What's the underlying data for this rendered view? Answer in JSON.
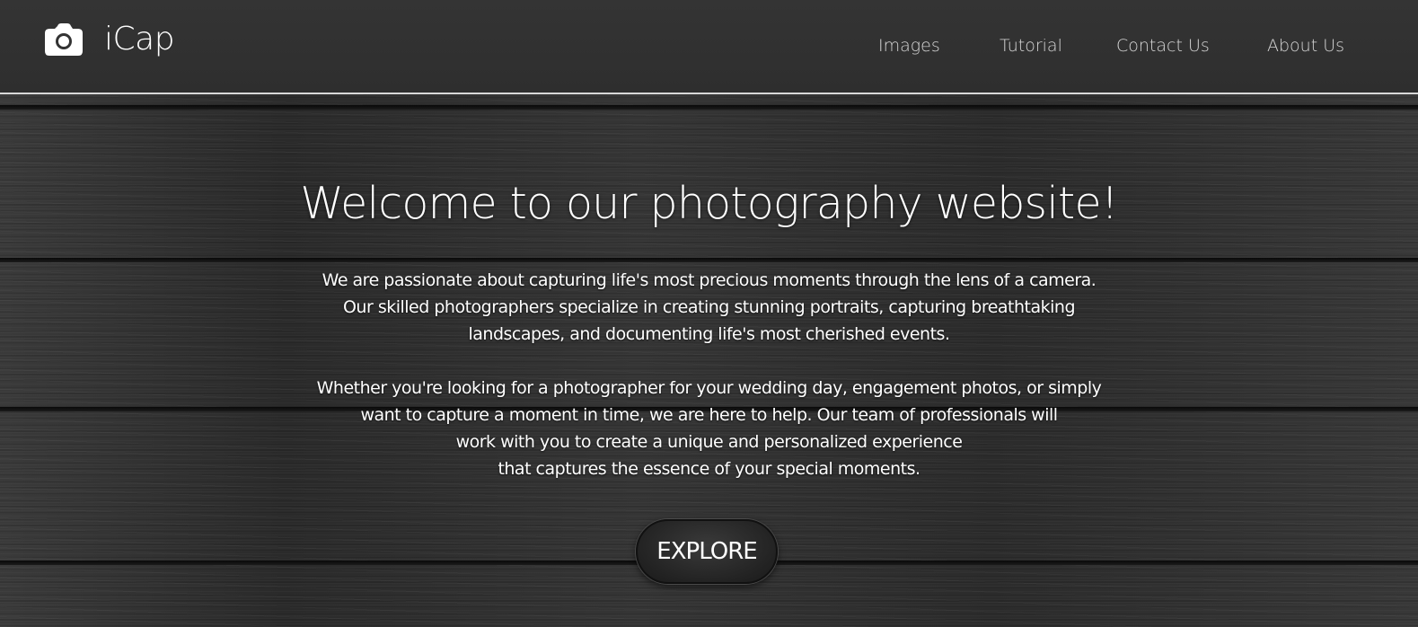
{
  "header": {
    "brand": "iCap",
    "logo_icon": "camera-icon",
    "nav": [
      {
        "label": "Images"
      },
      {
        "label": "Tutorial"
      },
      {
        "label": "Contact Us"
      },
      {
        "label": "About Us"
      }
    ]
  },
  "hero": {
    "title": "Welcome to our photography website!",
    "paragraph1": [
      "We are passionate about capturing life's most precious moments through the lens of a camera.",
      "Our skilled photographers specialize in creating stunning portraits, capturing breathtaking",
      "landscapes, and documenting life's most cherished events."
    ],
    "paragraph2": [
      "Whether you're looking for a photographer for your wedding day, engagement photos, or simply",
      "want to capture a moment in time, we are here to help. Our team of professionals will",
      "work with you to create a unique and personalized experience",
      "that captures the essence of your special moments."
    ],
    "cta_label": "EXPLORE"
  },
  "colors": {
    "header_bg": "#313131",
    "nav_text": "#d6d6d6",
    "text": "#ffffff"
  }
}
